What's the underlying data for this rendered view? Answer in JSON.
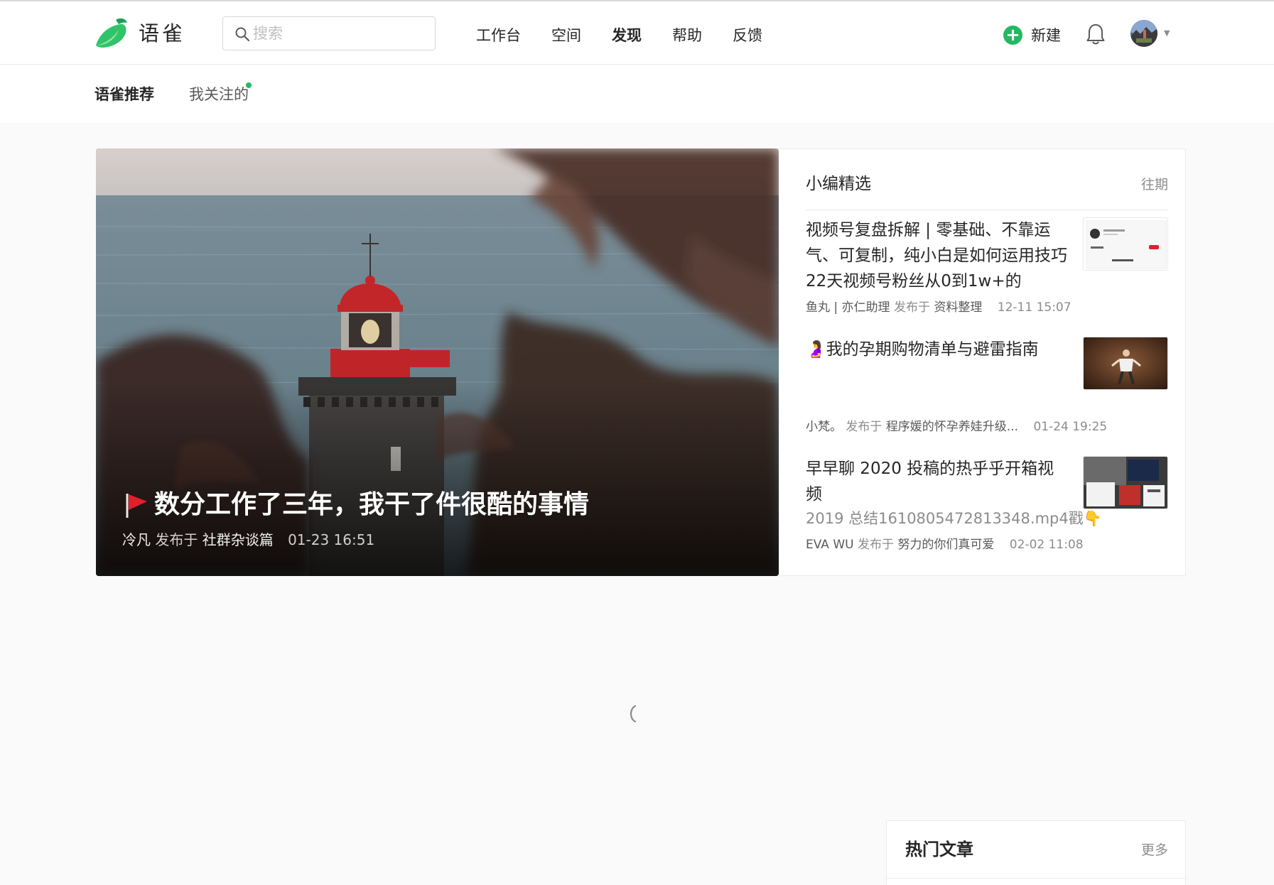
{
  "header": {
    "brand": "语雀",
    "search_placeholder": "搜索",
    "nav": [
      "工作台",
      "空间",
      "发现",
      "帮助",
      "反馈"
    ],
    "new_label": "新建"
  },
  "subnav": {
    "tabs": [
      "语雀推荐",
      "我关注的"
    ]
  },
  "hero": {
    "title": "数分工作了三年，我干了件很酷的事情",
    "author": "冷凡",
    "published_in": "发布于",
    "book": "社群杂谈篇",
    "time": "01-23 16:51"
  },
  "picks": {
    "title": "小编精选",
    "more": "往期",
    "items": [
      {
        "title": "视频号复盘拆解 | 零基础、不靠运气、可复制，纯小白是如何运用技巧22天视频号粉丝从0到1w+的",
        "author": "鱼丸 | 亦仁助理",
        "published_in": "发布于",
        "book": "资料整理",
        "time": "12-11 15:07"
      },
      {
        "title": "我的孕期购物清单与避雷指南",
        "author": "小梵。",
        "published_in": "发布于",
        "book": "程序媛的怀孕养娃升级...",
        "time": "01-24 19:25"
      },
      {
        "title": "早早聊 2020 投稿的热乎乎开箱视频",
        "extra": "2019 总结1610805472813348.mp4戳👇",
        "author": "EVA WU",
        "published_in": "发布于",
        "book": "努力的你们真可爱",
        "time": "02-02 11:08"
      }
    ]
  },
  "hot": {
    "title": "热门文章",
    "more": "更多"
  },
  "colors": {
    "brand_green": "#25b864",
    "text_primary": "#262626",
    "text_secondary": "#8c8c8c"
  }
}
